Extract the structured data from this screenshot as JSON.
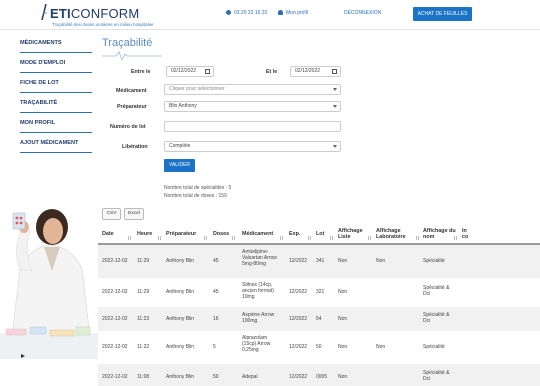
{
  "header": {
    "brand_prefix": "ETI",
    "brand_suffix": "CONFORM",
    "tagline": "Traçabilité des doses unitaires en milieu hospitalier",
    "phone": "03 20 23 16 20",
    "profile_label": "Mon profil",
    "logout_label": "DÉCONNEXION",
    "buy_label": "ACHAT DE FEUILLES"
  },
  "sidebar": {
    "items": [
      {
        "label": "MÉDICAMENTS"
      },
      {
        "label": "MODE D'EMPLOI"
      },
      {
        "label": "FICHE DE LOT"
      },
      {
        "label": "TRAÇABILITÉ"
      },
      {
        "label": "MON PROFIL"
      },
      {
        "label": "AJOUT MÉDICAMENT"
      }
    ]
  },
  "page": {
    "title": "Traçabilité"
  },
  "form": {
    "date_from_label": "Entre le",
    "date_from_value": "02/12/2022",
    "date_to_label": "Et le",
    "date_to_value": "02/12/2022",
    "medicament_label": "Médicament",
    "medicament_placeholder": "Cliquer pour sélectionner",
    "preparateur_label": "Préparateur",
    "preparateur_value": "Blin Anthony",
    "lot_label": "Numéro de lot",
    "lot_value": "",
    "liberation_label": "Libération",
    "liberation_value": "Complète",
    "validate_label": "VALIDER"
  },
  "summary": {
    "specialites": "Nombre total de spécialités : 5",
    "doses": "Nombre total de doses : 159"
  },
  "toolbar": {
    "csv_label": "CSV",
    "excel_label": "Excel"
  },
  "table": {
    "columns": [
      "Date",
      "Heure",
      "Préparateur",
      "Doses",
      "Médicament",
      "Exp.",
      "Lot",
      "Affichage Liste",
      "Affichage Laboratoire",
      "Affichage du nom",
      "In co"
    ],
    "rows": [
      {
        "date": "2022-12-02",
        "heure": "11:29",
        "preparateur": "Anthony Blin",
        "doses": "45",
        "medicament": "Amlodipine-Valsartan Arrow 5mg-80mg",
        "exp": "12/2022",
        "lot": "341",
        "liste": "Non",
        "labo": "Non",
        "nom": "Spécialité"
      },
      {
        "date": "2022-12-02",
        "heure": "11:29",
        "preparateur": "Anthony Blin",
        "doses": "45",
        "medicament": "Stilnox (14cp, ancien format) 10mg",
        "exp": "12/2022",
        "lot": "321",
        "liste": "Non",
        "labo": "",
        "nom": "Spécialité & Dci"
      },
      {
        "date": "2022-12-02",
        "heure": "11:23",
        "preparateur": "Anthony Blin",
        "doses": "16",
        "medicament": "Aspirine Arrow 100mg",
        "exp": "12/2022",
        "lot": "54",
        "liste": "Non",
        "labo": "",
        "nom": "Spécialité & Dci"
      },
      {
        "date": "2022-12-02",
        "heure": "11:22",
        "preparateur": "Anthony Blin",
        "doses": "5",
        "medicament": "Alprazolam (15cp) Arrow 0,25mg",
        "exp": "12/2022",
        "lot": "50",
        "liste": "Non",
        "labo": "Non",
        "nom": "Spécialité"
      },
      {
        "date": "2022-12-02",
        "heure": "11:08",
        "preparateur": "Anthony Blin",
        "doses": "50",
        "medicament": "Adepal",
        "exp": "12/2022",
        "lot": "0005",
        "liste": "Non",
        "labo": "",
        "nom": "Spécialité & Dci"
      }
    ]
  },
  "colors": {
    "primary": "#1a73c7",
    "brand_dark": "#1f3c6e",
    "title": "#5b8dc4"
  }
}
